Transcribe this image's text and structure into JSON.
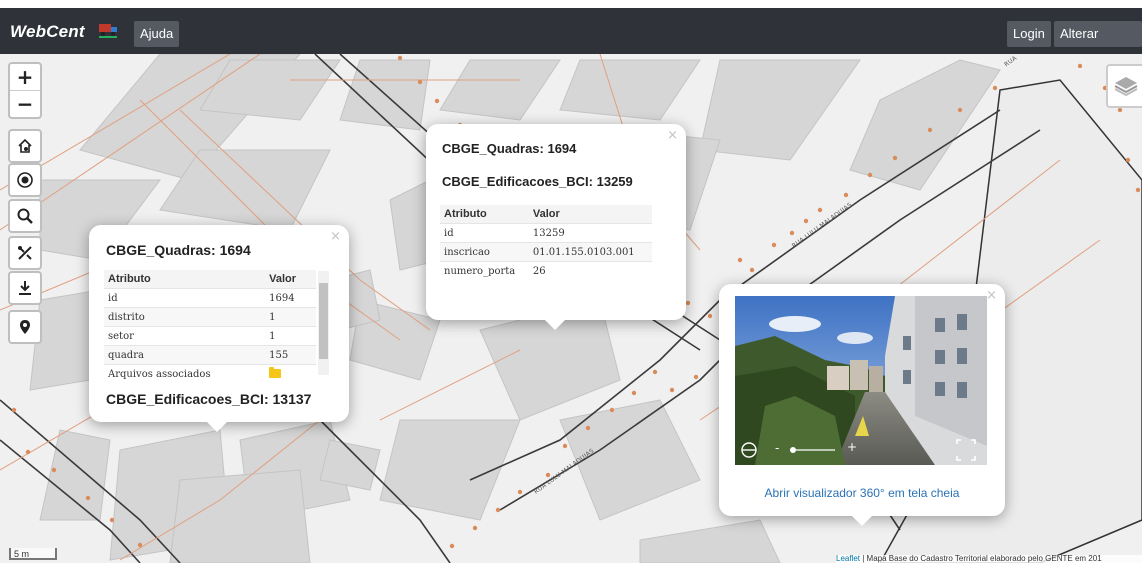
{
  "header": {
    "logo_text": "WebCent",
    "help_label": "Ajuda",
    "login_label": "Login",
    "change_password_label": "Alterar senha"
  },
  "map": {
    "zoom_in": "+",
    "zoom_out": "−",
    "scale_label": "5 m",
    "street_labels": [
      "RUA LULU MALAQUIAS",
      "RUA LULU MALAQUIAS",
      "RUA"
    ],
    "attribution": {
      "leaflet": "Leaflet",
      "text": " | Mapa Base do Cadastro Territorial elaborado pelo GENTE em 201"
    },
    "controls": [
      "home-icon",
      "info-icon",
      "search-icon",
      "tools-icon",
      "download-icon",
      "location-pin-icon"
    ],
    "layers_icon": "layers-icon"
  },
  "popup_left": {
    "close": "×",
    "title_quadras": "CBGE_Quadras: 1694",
    "table_headers": [
      "Atributo",
      "Valor"
    ],
    "rows": [
      {
        "attr": "id",
        "value": "1694"
      },
      {
        "attr": "distrito",
        "value": "1"
      },
      {
        "attr": "setor",
        "value": "1"
      },
      {
        "attr": "quadra",
        "value": "155"
      },
      {
        "attr": "Arquivos associados",
        "value": ""
      }
    ],
    "title_edificacoes": "CBGE_Edificacoes_BCI: 13137"
  },
  "popup_center": {
    "close": "×",
    "title_quadras": "CBGE_Quadras: 1694",
    "title_edificacoes": "CBGE_Edificacoes_BCI: 13259",
    "table_headers": [
      "Atributo",
      "Valor"
    ],
    "rows": [
      {
        "attr": "id",
        "value": "13259"
      },
      {
        "attr": "inscricao",
        "value": "01.01.155.0103.001"
      },
      {
        "attr": "numero_porta",
        "value": "26"
      }
    ]
  },
  "popup_360": {
    "close": "×",
    "zoom_minus": "-",
    "zoom_plus": "+",
    "link_label": "Abrir visualizador 360° em tela cheia"
  },
  "colors": {
    "topbar": "#2f3239",
    "button": "#545962",
    "link": "#2a72b5",
    "road_line": "#e0a080",
    "block": "#d6d6d6"
  }
}
